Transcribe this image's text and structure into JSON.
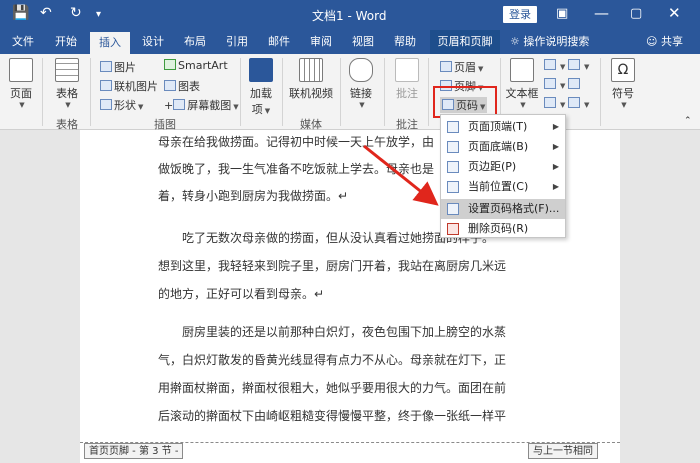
{
  "titlebar": {
    "title": "文档1 - Word",
    "login_label": "登录"
  },
  "tabs": [
    "文件",
    "开始",
    "插入",
    "设计",
    "布局",
    "引用",
    "邮件",
    "审阅",
    "视图",
    "帮助",
    "页眉和页脚"
  ],
  "active_tab": "插入",
  "tellme": "操作说明搜索",
  "share": "共享",
  "ribbon": {
    "page": "页面",
    "table": "表格",
    "table_group": "表格",
    "picture": "图片",
    "online_picture": "联机图片",
    "shapes": "形状",
    "smartart": "SmartArt",
    "chart": "图表",
    "screenshot": "屏幕截图",
    "illustrations_group": "插图",
    "addins": "加载",
    "addins2": "项",
    "online_video": "联机视频",
    "media_group": "媒体",
    "link": "链接",
    "comment": "批注",
    "comment_group": "批注",
    "header": "页眉",
    "footer": "页脚",
    "page_number": "页码",
    "textbox": "文本框",
    "symbol": "符号"
  },
  "menu": {
    "items": [
      {
        "label": "页面顶端(T)"
      },
      {
        "label": "页面底端(B)"
      },
      {
        "label": "页边距(P)"
      },
      {
        "label": "当前位置(C)"
      },
      {
        "label": "设置页码格式(F)..."
      },
      {
        "label": "删除页码(R)"
      }
    ]
  },
  "document": {
    "lines": [
      "母亲在给我做捞面。记得初中时候一天上午放学，由",
      "做饭晚了，我一生气准备不吃饭就上学去。母亲也是",
      "着，转身小跑到厨房为我做捞面。↵",
      "吃了无数次母亲做的捞面，但从没认真看过她捞面的样子。",
      "想到这里，我轻轻来到院子里，厨房门开着，我站在离厨房几米远",
      "的地方，正好可以看到母亲。↵",
      "厨房里装的还是以前那种白炽灯，夜色包围下加上膀空的水蒸",
      "气，白炽灯散发的昏黄光线显得有点力不从心。母亲就在灯下，正",
      "用擀面杖擀面，擀面杖很粗大，她似乎要用很大的力气。面团在前",
      "后滚动的擀面杖下由崎岖粗糙变得慢慢平整，终于像一张纸一样平"
    ],
    "footer_left": "首页页脚 - 第 3 节 -",
    "footer_right": "与上一节相同"
  },
  "colors": {
    "word_blue": "#2b579a",
    "highlight_red": "#e0261c"
  }
}
